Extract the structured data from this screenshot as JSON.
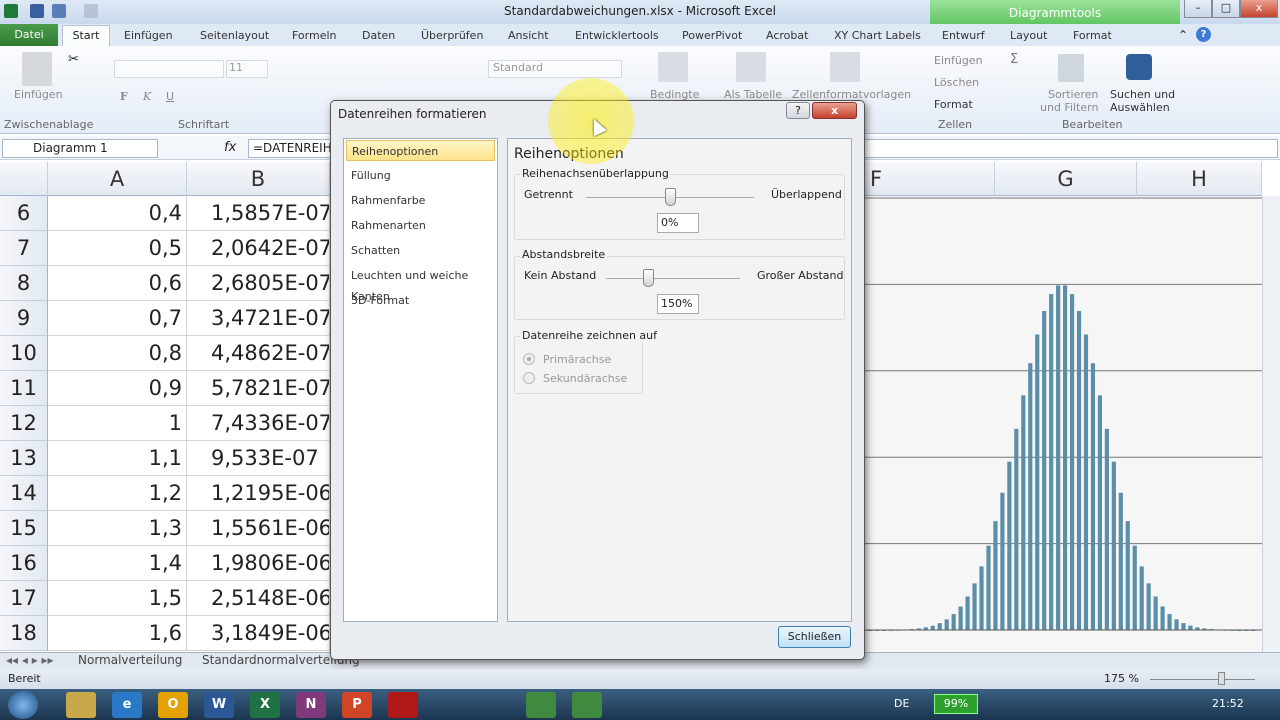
{
  "window": {
    "title": "Standardabweichungen.xlsx - Microsoft Excel",
    "context_tab": "Diagrammtools"
  },
  "tabs": [
    "Datei",
    "Start",
    "Einfügen",
    "Seitenlayout",
    "Formeln",
    "Daten",
    "Überprüfen",
    "Ansicht",
    "Entwicklertools",
    "PowerPivot",
    "Acrobat",
    "XY Chart Labels",
    "Entwurf",
    "Layout",
    "Format"
  ],
  "ribbon": {
    "paste": "Einfügen",
    "font_size": "11",
    "number_format": "Standard",
    "bedingte": "Bedingte",
    "als_tabelle": "Als Tabelle",
    "zellenformat": "Zellenformatvorlagen",
    "einfuegen": "Einfügen",
    "loeschen": "Löschen",
    "format": "Format",
    "sortieren1": "Sortieren",
    "sortieren2": "und Filtern",
    "suchen1": "Suchen und",
    "suchen2": "Auswählen",
    "sigma": "Σ",
    "groups": [
      "Zwischenablage",
      "Schriftart",
      "Zellen",
      "Bearbeiten"
    ]
  },
  "formula_bar": {
    "name_box": "Diagramm 1",
    "fx": "fx",
    "formula": "=DATENREIHE("
  },
  "columns": [
    "A",
    "B",
    "F",
    "G",
    "H"
  ],
  "rows": [
    {
      "n": "6",
      "a": "0,4",
      "b": "1,5857E-07"
    },
    {
      "n": "7",
      "a": "0,5",
      "b": "2,0642E-07"
    },
    {
      "n": "8",
      "a": "0,6",
      "b": "2,6805E-07"
    },
    {
      "n": "9",
      "a": "0,7",
      "b": "3,4721E-07"
    },
    {
      "n": "10",
      "a": "0,8",
      "b": "4,4862E-07"
    },
    {
      "n": "11",
      "a": "0,9",
      "b": "5,7821E-07"
    },
    {
      "n": "12",
      "a": "1",
      "b": "7,4336E-07"
    },
    {
      "n": "13",
      "a": "1,1",
      "b": "9,533E-07"
    },
    {
      "n": "14",
      "a": "1,2",
      "b": "1,2195E-06"
    },
    {
      "n": "15",
      "a": "1,3",
      "b": "1,5561E-06"
    },
    {
      "n": "16",
      "a": "1,4",
      "b": "1,9806E-06"
    },
    {
      "n": "17",
      "a": "1,5",
      "b": "2,5148E-06"
    },
    {
      "n": "18",
      "a": "1,6",
      "b": "3,1849E-06"
    }
  ],
  "sheet_tabs": [
    "Normalverteilung",
    "Standardnormalverteilung"
  ],
  "status": {
    "ready": "Bereit",
    "zoom": "175 %"
  },
  "taskbar": {
    "lang": "DE",
    "battery": "99%",
    "clock": "21:52",
    "apps": [
      "O",
      "W",
      "X",
      "N",
      "P"
    ]
  },
  "dialog": {
    "title": "Datenreihen formatieren",
    "help": "?",
    "close_x": "x",
    "nav": [
      "Reihenoptionen",
      "Füllung",
      "Rahmenfarbe",
      "Rahmenarten",
      "Schatten",
      "Leuchten und weiche Kanten",
      "3D-Format"
    ],
    "heading": "Reihenoptionen",
    "overlap": {
      "label": "Reihenachsenüberlappung",
      "left": "Getrennt",
      "right": "Überlappend",
      "value": "0%",
      "level": 0
    },
    "gap": {
      "label": "Abstandsbreite",
      "left": "Kein Abstand",
      "right": "Großer Abstand",
      "value": "150%",
      "level": 150
    },
    "axis": {
      "label": "Datenreihe zeichnen auf",
      "primary": "Primärachse",
      "secondary": "Sekundärachse",
      "selected": "Primärachse"
    },
    "close_button": "Schließen"
  },
  "chart_data": {
    "type": "bar",
    "grid": true,
    "ylim": [
      0,
      1.25
    ],
    "bar_color": "#5b8fa8",
    "values": [
      0.0001,
      0.0001,
      0.0002,
      0.0005,
      0.0009,
      0.0015,
      0.0027,
      0.0046,
      0.0077,
      0.0125,
      0.0198,
      0.0307,
      0.046,
      0.068,
      0.097,
      0.135,
      0.184,
      0.244,
      0.315,
      0.397,
      0.487,
      0.582,
      0.679,
      0.772,
      0.855,
      0.923,
      0.972,
      0.997,
      0.997,
      0.972,
      0.923,
      0.855,
      0.772,
      0.679,
      0.582,
      0.487,
      0.397,
      0.315,
      0.244,
      0.184,
      0.135,
      0.097,
      0.068,
      0.046,
      0.0307,
      0.0198,
      0.0125,
      0.0077,
      0.0046,
      0.0027,
      0.0015,
      0.0009,
      0.0005,
      0.0002,
      0.0001,
      0.0001
    ]
  }
}
